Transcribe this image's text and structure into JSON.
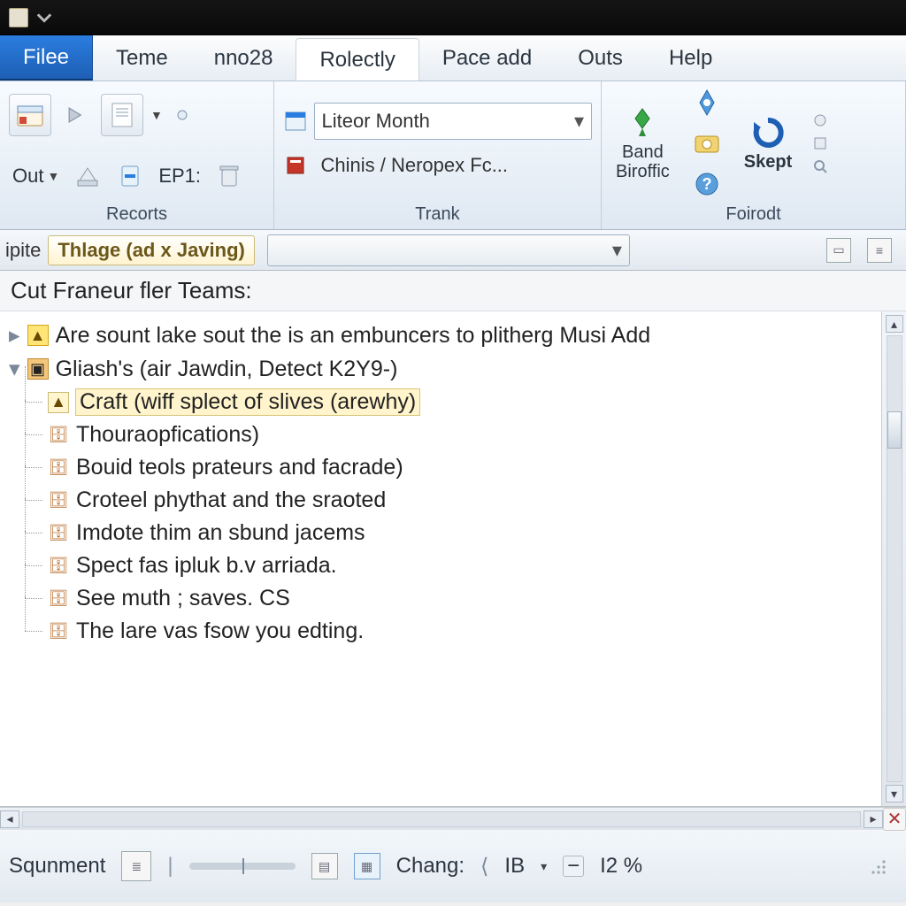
{
  "menu": {
    "file": "Filee",
    "items": [
      "Teme",
      "nno28",
      "Rolectly",
      "Pace add",
      "Outs",
      "Help"
    ],
    "active_index": 2
  },
  "ribbon": {
    "group1": {
      "out_label": "Out",
      "ep_label": "EP1:",
      "label": "Recorts"
    },
    "group2": {
      "combo1": "Liteor Month",
      "combo2": "Chinis / Neropex Fc...",
      "label": "Trank"
    },
    "group3": {
      "band": "Band",
      "biroffic": "Biroffic",
      "skept": "Skept",
      "label": "Foirodt"
    }
  },
  "subbar": {
    "left_text": "ipite",
    "tab_label": "Thlage (ad x Javing)"
  },
  "panel_title": "Cut Franeur fler Teams:",
  "tree": {
    "root1": "Are sount lake sout the is an embuncers to plitherg Musi Add",
    "root2": "Gliash's (air Jawdin, Detect K2Y9-)",
    "children": [
      "Craft (wiff splect of slives (arewhy)",
      "Thouraopfications)",
      "Bouid teols prateurs and facrade)",
      "Croteel phythat and the sraoted",
      "Imdote thim an sbund jacems",
      "Spect fas ipluk b.v arriada.",
      "See muth ; saves. CS",
      "The lare vas fsow you edting."
    ],
    "highlight_index": 0
  },
  "status": {
    "left": "Squnment",
    "chang": "Chang:",
    "ib": "IB",
    "zoom": "I2 %"
  }
}
